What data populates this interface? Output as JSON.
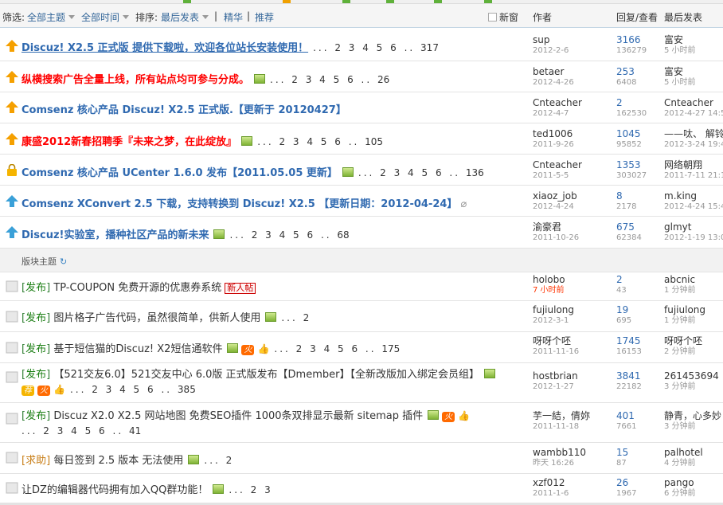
{
  "header": {
    "filter_label": "筛选:",
    "all_topics": "全部主题",
    "all_time": "全部时间",
    "sort_label": "排序:",
    "sort_value": "最后发表",
    "digest": "精华",
    "recommend": "推荐",
    "new_window": "新窗",
    "col_author": "作者",
    "col_replies": "回复/查看",
    "col_last": "最后发表"
  },
  "section_label": "版块主题",
  "threads": [
    {
      "title": "Discuz! X2.5 正式版 提供下载啦，欢迎各位站长安装使用！",
      "pages": "... 2 3 4 5 6 ..",
      "last_page": "317",
      "author": "sup",
      "date": "2012-2-6",
      "replies": "3166",
      "views": "136279",
      "last_user": "富安",
      "last_time": "5 小时前"
    },
    {
      "title": "纵横搜索广告全量上线，所有站点均可参与分成。",
      "pages": "... 2 3 4 5 6 ..",
      "last_page": "26",
      "author": "betaer",
      "date": "2012-4-26",
      "replies": "253",
      "views": "6408",
      "last_user": "富安",
      "last_time": "5 小时前"
    },
    {
      "title": "Comsenz 核心产品 Discuz! X2.5 正式版.【更新于 20120427】",
      "pages": "",
      "last_page": "",
      "author": "Cnteacher",
      "date": "2012-4-7",
      "replies": "2",
      "views": "162530",
      "last_user": "Cnteacher",
      "last_time": "2012-4-27 14:5"
    },
    {
      "title": "康盛2012新春招聘季『未来之梦，在此绽放』",
      "pages": "... 2 3 4 5 6 ..",
      "last_page": "105",
      "author": "ted1006",
      "date": "2011-9-26",
      "replies": "1045",
      "views": "95852",
      "last_user": "——呔、 解铃",
      "last_time": "2012-3-24 19:4"
    },
    {
      "title": "Comsenz 核心产品 UCenter 1.6.0 发布【2011.05.05 更新】",
      "pages": "... 2 3 4 5 6 ..",
      "last_page": "136",
      "author": "Cnteacher",
      "date": "2011-5-5",
      "replies": "1353",
      "views": "303027",
      "last_user": "网络朝翔",
      "last_time": "2011-7-11 21:1"
    },
    {
      "title": "Comsenz XConvert 2.5 下载，支持转换到 Discuz! X2.5 【更新日期：2012-04-24】",
      "pages": "",
      "last_page": "",
      "author": "xiaoz_job",
      "date": "2012-4-24",
      "replies": "8",
      "views": "2178",
      "last_user": "m.king",
      "last_time": "2012-4-24 15:4"
    },
    {
      "title": "Discuz!实验室，播种社区产品的新未来",
      "pages": "... 2 3 4 5 6 ..",
      "last_page": "68",
      "author": "渝豪君",
      "date": "2011-10-26",
      "replies": "675",
      "views": "62384",
      "last_user": "glmyt",
      "last_time": "2012-1-19 13:0"
    },
    {
      "tag": "发布",
      "title": "TP-COUPON 免费开源的优惠券系统",
      "badge": "新人帖",
      "pages": "",
      "last_page": "",
      "author": "holobo",
      "date": "7 小时前",
      "replies": "2",
      "views": "43",
      "last_user": "abcnic",
      "last_time": "1 分钟前"
    },
    {
      "tag": "发布",
      "title": "图片格子广告代码，虽然很简单，供新人使用",
      "pages": "...",
      "last_page": "2",
      "author": "fujiulong",
      "date": "2012-3-1",
      "replies": "19",
      "views": "695",
      "last_user": "fujiulong",
      "last_time": "1 分钟前"
    },
    {
      "tag": "发布",
      "title": "基于短信猫的Discuz! X2短信通软件",
      "pages": "... 2 3 4 5 6 ..",
      "last_page": "175",
      "author": "呀呀个呸",
      "date": "2011-11-16",
      "replies": "1745",
      "views": "16153",
      "last_user": "呀呀个呸",
      "last_time": "2 分钟前"
    },
    {
      "tag": "发布",
      "title": "【521交友6.0】521交友中心 6.0版 正式版发布【Dmember】【全新改版加入绑定会员组】",
      "pages": "... 2 3 4 5 6 ..",
      "last_page": "385",
      "author": "hostbrian",
      "date": "2012-1-27",
      "replies": "3841",
      "views": "22182",
      "last_user": "261453694",
      "last_time": "3 分钟前"
    },
    {
      "tag": "发布",
      "title": "Discuz X2.0 X2.5 网站地图 免费SEO插件 1000条双排显示最新 sitemap 插件",
      "pages": "... 2 3 4 5 6 ..",
      "last_page": "41",
      "author": "芋一結，倩妳",
      "date": "2011-11-18",
      "replies": "401",
      "views": "7661",
      "last_user": "静青，心多妙",
      "last_time": "3 分钟前"
    },
    {
      "tag": "求助",
      "title": "每日签到 2.5 版本 无法使用",
      "pages": "...",
      "last_page": "2",
      "author": "wambb110",
      "date": "昨天 16:26",
      "replies": "15",
      "views": "87",
      "last_user": "palhotel",
      "last_time": "4 分钟前"
    },
    {
      "title": "让DZ的编辑器代码拥有加入QQ群功能！",
      "pages": "... 2 3",
      "last_page": "",
      "author": "xzf012",
      "date": "2011-1-6",
      "replies": "26",
      "views": "1967",
      "last_user": "pango",
      "last_time": "6 分钟前"
    }
  ],
  "hot_label": "火",
  "rec_label": "荐",
  "colors": {
    "accent_blue": "#2f69b0",
    "red_title": "#ff0000",
    "tag_green": "#1a7e12",
    "header_border": "#c2d5e3"
  }
}
